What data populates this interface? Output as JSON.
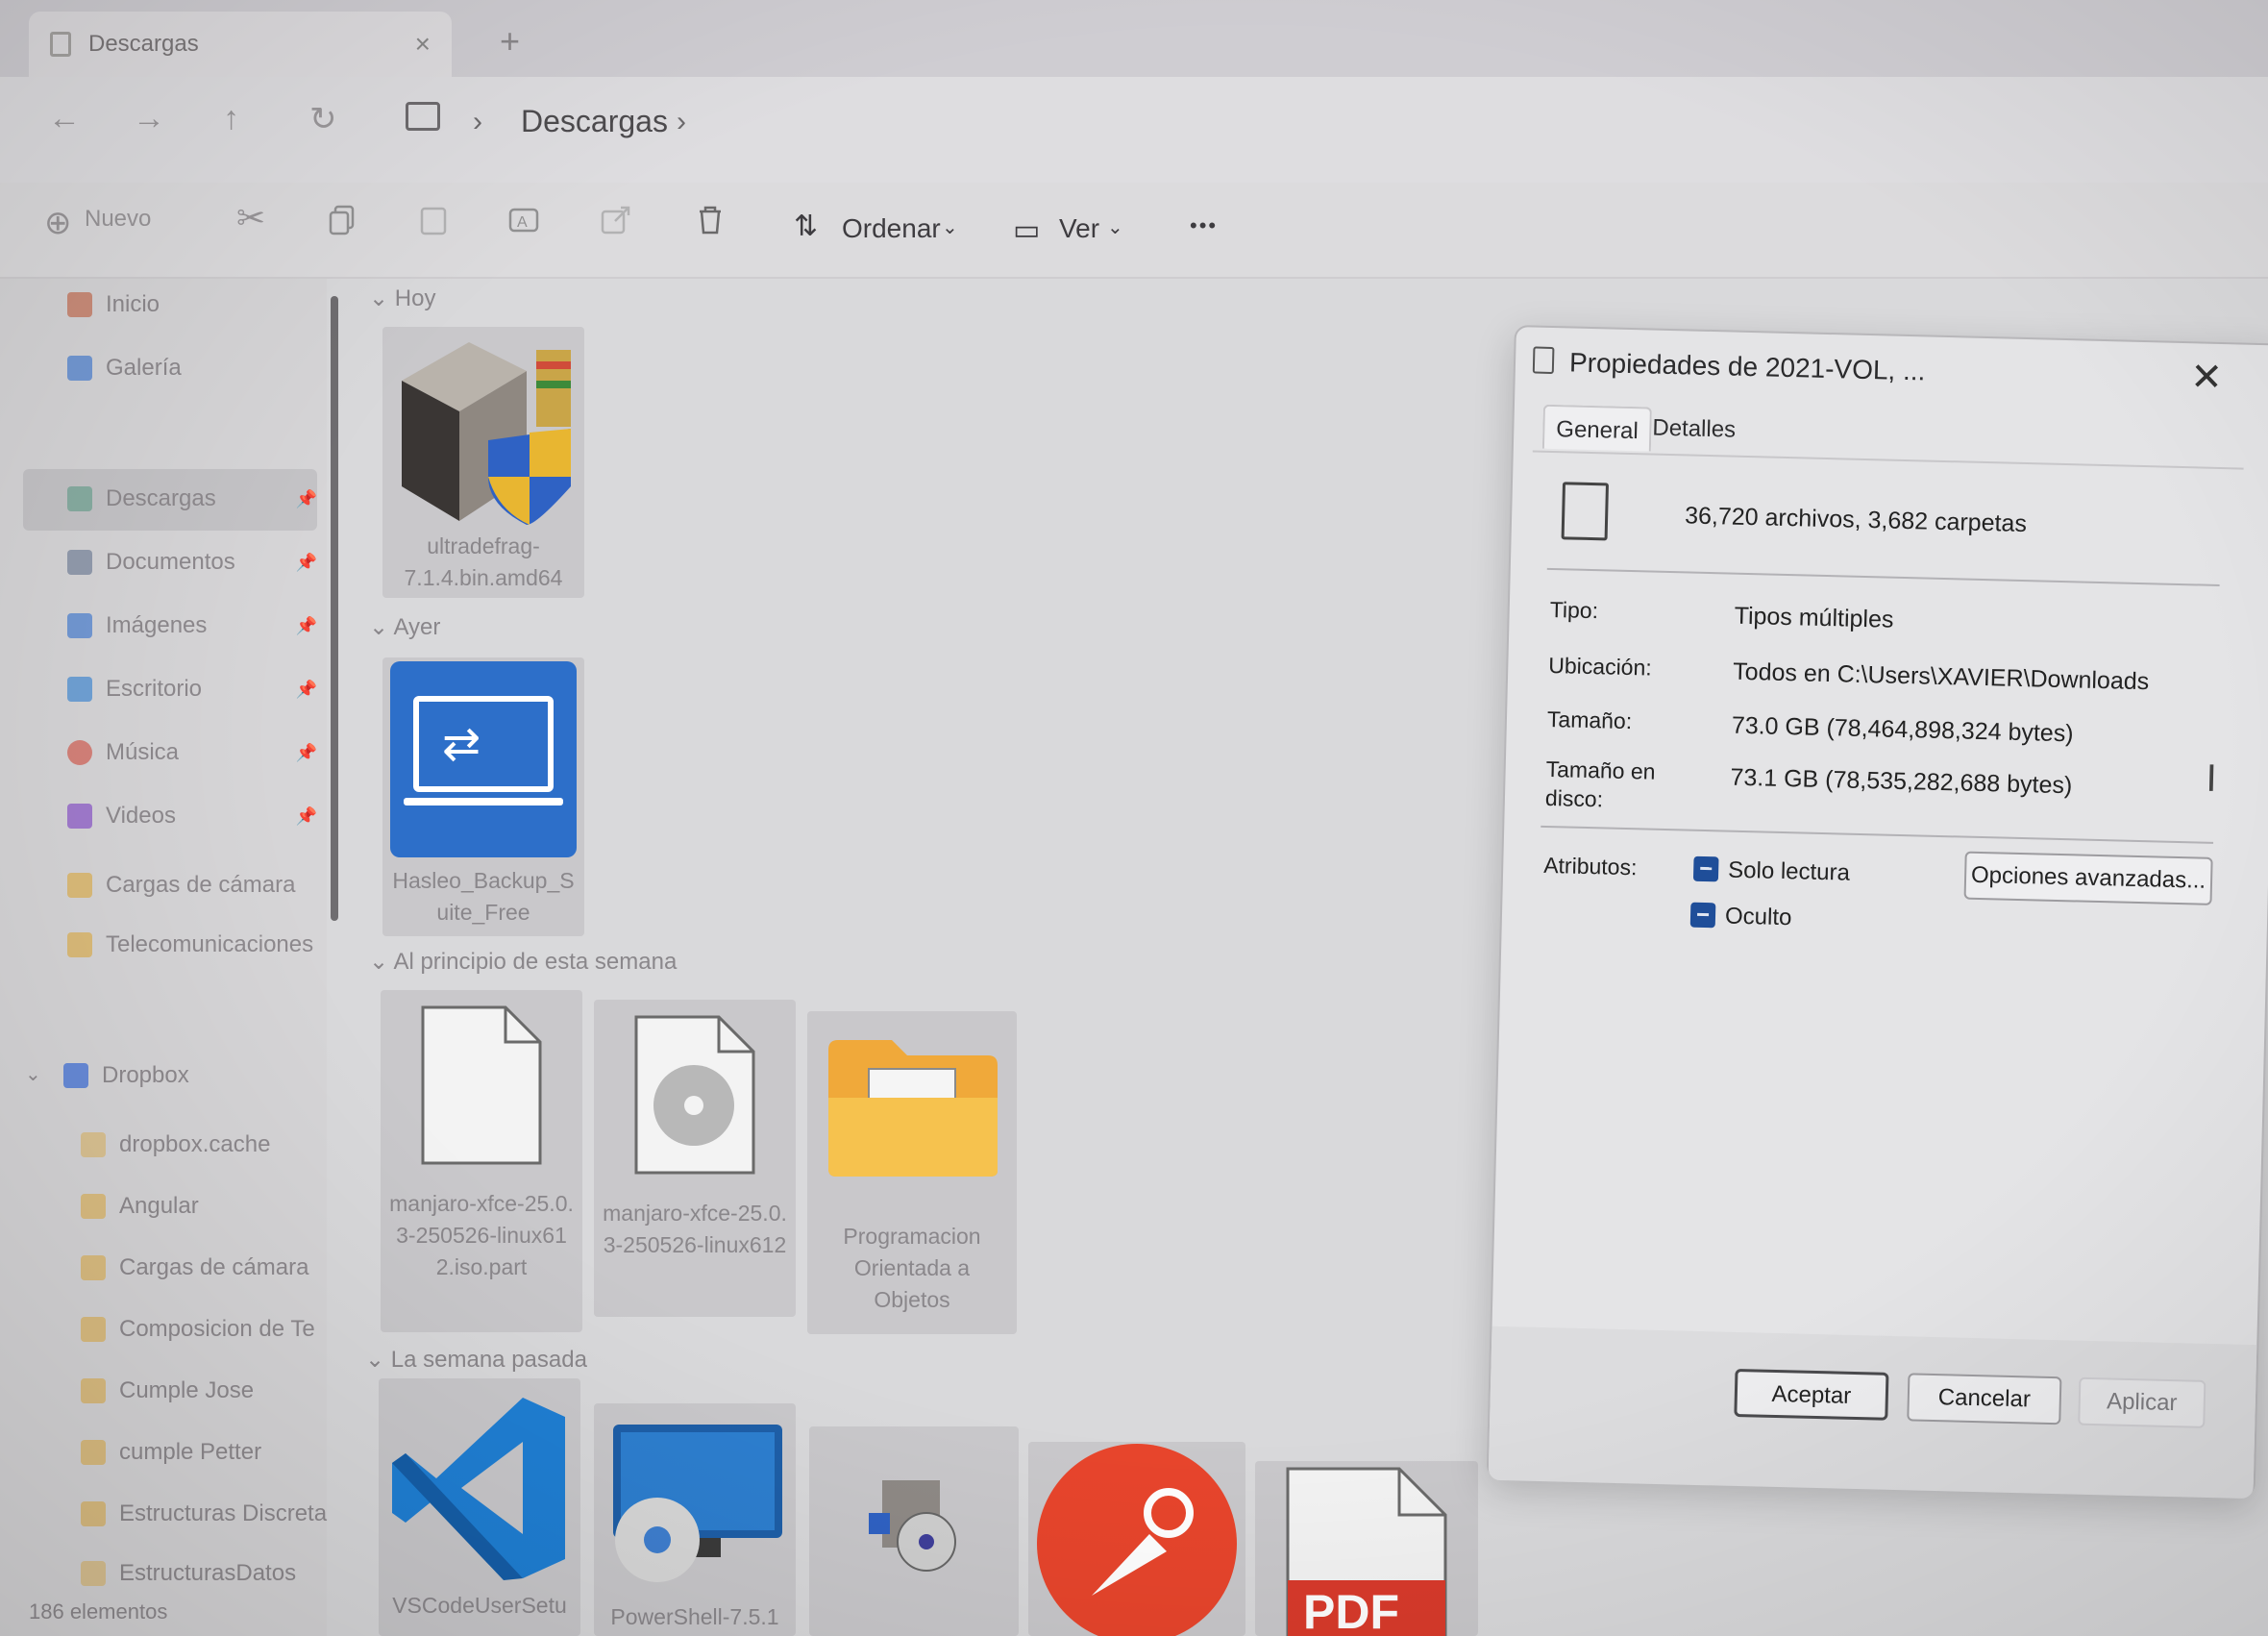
{
  "window": {
    "tab_title": "Descargas",
    "tab_close": "×",
    "new_tab": "+"
  },
  "addressbar": {
    "back": "←",
    "forward": "→",
    "up": "↑",
    "refresh": "↻",
    "separator": "›",
    "location": "Descargas"
  },
  "commandbar": {
    "new_label": "Nuevo",
    "sort_label": "Ordenar",
    "view_label": "Ver",
    "more_label": "•••"
  },
  "sidebar": {
    "items": [
      {
        "label": "Inicio",
        "color": "#c25b3a",
        "pinned": false
      },
      {
        "label": "Galería",
        "color": "#2f6fd1",
        "pinned": false
      },
      {
        "label": "Descargas",
        "color": "#2c8a6a",
        "pinned": true
      },
      {
        "label": "Documentos",
        "color": "#5b6c8a",
        "pinned": true
      },
      {
        "label": "Imágenes",
        "color": "#2f6fd1",
        "pinned": true
      },
      {
        "label": "Escritorio",
        "color": "#2a7fd4",
        "pinned": true
      },
      {
        "label": "Música",
        "color": "#d24a3a",
        "pinned": true
      },
      {
        "label": "Videos",
        "color": "#7b3ec7",
        "pinned": true
      },
      {
        "label": "Cargas de cámara",
        "color": "#e0a62b",
        "pinned": false
      },
      {
        "label": "Telecomunicaciones",
        "color": "#e0a62b",
        "pinned": false
      }
    ],
    "dropbox": {
      "label": "Dropbox",
      "children": [
        "dropbox.cache",
        "Angular",
        "Cargas de cámara",
        "Composicion de Te",
        "Cumple Jose",
        "cumple Petter",
        "Estructuras Discreta",
        "EstructurasDatos"
      ]
    },
    "status": "186 elementos"
  },
  "content": {
    "sections": [
      {
        "title": "Hoy"
      },
      {
        "title": "Ayer"
      },
      {
        "title": "Al principio de esta semana"
      },
      {
        "title": "La semana pasada"
      }
    ],
    "files": {
      "ultradefrag": "ultradefrag-7.1.4.bin.amd64",
      "hasleo": "Hasleo_Backup_Suite_Free",
      "manjaro_part": "manjaro-xfce-25.0.3-250526-linux612.iso.part",
      "manjaro_iso": "manjaro-xfce-25.0.3-250526-linux612",
      "programacion": "Programacion Orientada a Objetos",
      "vscode": "VSCodeUserSetu",
      "powershell": "PowerShell-7.5.1"
    }
  },
  "dialog": {
    "title": "Propiedades de 2021-VOL, ...",
    "close": "✕",
    "tabs": [
      "General",
      "Detalles"
    ],
    "summary": "36,720 archivos, 3,682 carpetas",
    "props": {
      "tipo_label": "Tipo:",
      "tipo_value": "Tipos múltiples",
      "ubicacion_label": "Ubicación:",
      "ubicacion_value": "Todos en C:\\Users\\XAVIER\\Downloads",
      "tamano_label": "Tamaño:",
      "tamano_value": "73.0 GB (78,464,898,324 bytes)",
      "tamano_disco_label": "Tamaño en disco:",
      "tamano_disco_value": "73.1 GB (78,535,282,688 bytes)"
    },
    "attributes": {
      "label": "Atributos:",
      "readonly": "Solo lectura",
      "hidden": "Oculto",
      "advanced": "Opciones avanzadas..."
    },
    "buttons": {
      "ok": "Aceptar",
      "cancel": "Cancelar",
      "apply": "Aplicar"
    }
  },
  "colors": {
    "accent": "#1f4e99",
    "folder": "#f2b53a",
    "pdf_red": "#d93a2b",
    "postman": "#e8452c",
    "vscode_blue": "#1f7fd4"
  }
}
